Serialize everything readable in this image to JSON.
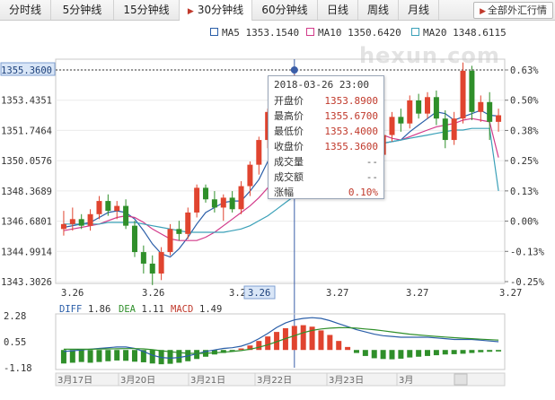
{
  "tabs": [
    {
      "label": "分时线",
      "active": false
    },
    {
      "label": "5分钟线",
      "active": false
    },
    {
      "label": "15分钟线",
      "active": false
    },
    {
      "label": "30分钟线",
      "active": true
    },
    {
      "label": "60分钟线",
      "active": false
    },
    {
      "label": "日线",
      "active": false
    },
    {
      "label": "周线",
      "active": false
    },
    {
      "label": "月线",
      "active": false
    }
  ],
  "fx_button": "全部外汇行情",
  "watermark": "hexun.com",
  "ma_legend": [
    {
      "name": "MA5",
      "value": "1353.1540",
      "color": "#2a5ea8"
    },
    {
      "name": "MA10",
      "value": "1350.6420",
      "color": "#d23a8a"
    },
    {
      "name": "MA20",
      "value": "1348.6115",
      "color": "#3aa0b8"
    }
  ],
  "tooltip": {
    "datetime": "2018-03-26 23:00",
    "rows": [
      {
        "label": "开盘价",
        "value": "1353.8900"
      },
      {
        "label": "最高价",
        "value": "1355.6700"
      },
      {
        "label": "最低价",
        "value": "1353.4000"
      },
      {
        "label": "收盘价",
        "value": "1355.3600"
      },
      {
        "label": "成交量",
        "value": "--"
      },
      {
        "label": "成交额",
        "value": "--"
      },
      {
        "label": "涨幅",
        "value": "0.10%"
      }
    ]
  },
  "chart_data": {
    "type": "candlestick",
    "current_price_label": "1355.3600",
    "current_price": 1355.36,
    "y_range": [
      1343.0,
      1356.6
    ],
    "y_ticks": [
      "1355.3600",
      "1353.4351",
      "1351.7464",
      "1350.0576",
      "1348.3689",
      "1346.6801",
      "1344.9914",
      "1343.3026"
    ],
    "pct_ticks": [
      "0.63%",
      "0.50%",
      "0.38%",
      "0.25%",
      "0.13%",
      "0.00%",
      "-0.13%",
      "-0.25%"
    ],
    "x_labels": [
      "3.26",
      "3.26",
      "3.2",
      "3.26",
      "3.27",
      "3.27",
      "3.27"
    ],
    "crosshair_label": "3.26",
    "candles": [
      {
        "o": 1346.3,
        "h": 1347.4,
        "l": 1345.9,
        "c": 1346.6
      },
      {
        "o": 1346.6,
        "h": 1347.6,
        "l": 1346.2,
        "c": 1346.9
      },
      {
        "o": 1346.9,
        "h": 1347.2,
        "l": 1346.3,
        "c": 1346.5
      },
      {
        "o": 1346.5,
        "h": 1347.5,
        "l": 1346.2,
        "c": 1347.2
      },
      {
        "o": 1347.2,
        "h": 1348.3,
        "l": 1346.9,
        "c": 1348.0
      },
      {
        "o": 1348.0,
        "h": 1348.4,
        "l": 1347.1,
        "c": 1347.4
      },
      {
        "o": 1347.4,
        "h": 1348.0,
        "l": 1346.9,
        "c": 1347.7
      },
      {
        "o": 1347.7,
        "h": 1348.1,
        "l": 1346.3,
        "c": 1346.5
      },
      {
        "o": 1346.5,
        "h": 1346.8,
        "l": 1344.6,
        "c": 1344.9
      },
      {
        "o": 1344.9,
        "h": 1345.3,
        "l": 1343.6,
        "c": 1344.2
      },
      {
        "o": 1344.2,
        "h": 1344.7,
        "l": 1342.9,
        "c": 1343.6
      },
      {
        "o": 1343.6,
        "h": 1345.2,
        "l": 1343.2,
        "c": 1344.9
      },
      {
        "o": 1344.9,
        "h": 1346.6,
        "l": 1344.7,
        "c": 1346.3
      },
      {
        "o": 1346.3,
        "h": 1346.8,
        "l": 1345.6,
        "c": 1346.0
      },
      {
        "o": 1346.0,
        "h": 1347.6,
        "l": 1345.7,
        "c": 1347.3
      },
      {
        "o": 1347.3,
        "h": 1349.0,
        "l": 1347.0,
        "c": 1348.8
      },
      {
        "o": 1348.8,
        "h": 1349.0,
        "l": 1347.9,
        "c": 1348.1
      },
      {
        "o": 1348.1,
        "h": 1348.6,
        "l": 1347.3,
        "c": 1347.6
      },
      {
        "o": 1347.6,
        "h": 1348.4,
        "l": 1346.8,
        "c": 1348.2
      },
      {
        "o": 1348.2,
        "h": 1348.6,
        "l": 1347.3,
        "c": 1347.5
      },
      {
        "o": 1347.5,
        "h": 1349.2,
        "l": 1347.2,
        "c": 1348.9
      },
      {
        "o": 1348.9,
        "h": 1350.4,
        "l": 1348.3,
        "c": 1350.2
      },
      {
        "o": 1350.2,
        "h": 1351.9,
        "l": 1349.6,
        "c": 1351.7
      },
      {
        "o": 1351.7,
        "h": 1353.6,
        "l": 1351.2,
        "c": 1353.4
      },
      {
        "o": 1353.4,
        "h": 1355.4,
        "l": 1352.8,
        "c": 1354.2
      },
      {
        "o": 1354.2,
        "h": 1355.3,
        "l": 1353.5,
        "c": 1353.9
      },
      {
        "o": 1353.9,
        "h": 1355.67,
        "l": 1353.4,
        "c": 1355.36
      },
      {
        "o": 1355.3,
        "h": 1355.6,
        "l": 1354.4,
        "c": 1354.7
      },
      {
        "o": 1354.7,
        "h": 1355.4,
        "l": 1354.2,
        "c": 1355.0
      },
      {
        "o": 1355.0,
        "h": 1355.2,
        "l": 1353.9,
        "c": 1354.3
      },
      {
        "o": 1352.0,
        "h": 1352.4,
        "l": 1350.6,
        "c": 1351.0
      },
      {
        "o": 1351.0,
        "h": 1352.0,
        "l": 1350.5,
        "c": 1351.7
      },
      {
        "o": 1351.7,
        "h": 1352.2,
        "l": 1350.8,
        "c": 1351.2
      },
      {
        "o": 1351.2,
        "h": 1352.4,
        "l": 1350.6,
        "c": 1352.1
      },
      {
        "o": 1352.1,
        "h": 1352.5,
        "l": 1351.3,
        "c": 1351.6
      },
      {
        "o": 1351.6,
        "h": 1352.0,
        "l": 1350.4,
        "c": 1350.8
      },
      {
        "o": 1350.8,
        "h": 1352.3,
        "l": 1350.6,
        "c": 1352.0
      },
      {
        "o": 1352.0,
        "h": 1353.4,
        "l": 1351.6,
        "c": 1353.1
      },
      {
        "o": 1353.1,
        "h": 1353.6,
        "l": 1352.2,
        "c": 1352.7
      },
      {
        "o": 1352.7,
        "h": 1354.4,
        "l": 1352.4,
        "c": 1354.1
      },
      {
        "o": 1354.1,
        "h": 1354.5,
        "l": 1353.0,
        "c": 1353.3
      },
      {
        "o": 1353.3,
        "h": 1354.6,
        "l": 1353.0,
        "c": 1354.3
      },
      {
        "o": 1354.3,
        "h": 1354.7,
        "l": 1352.6,
        "c": 1353.0
      },
      {
        "o": 1353.0,
        "h": 1353.5,
        "l": 1351.2,
        "c": 1351.7
      },
      {
        "o": 1351.7,
        "h": 1353.4,
        "l": 1351.4,
        "c": 1353.0
      },
      {
        "o": 1353.0,
        "h": 1356.4,
        "l": 1352.7,
        "c": 1355.9
      },
      {
        "o": 1355.9,
        "h": 1356.2,
        "l": 1352.9,
        "c": 1353.4
      },
      {
        "o": 1353.4,
        "h": 1354.4,
        "l": 1352.8,
        "c": 1354.0
      },
      {
        "o": 1354.0,
        "h": 1354.6,
        "l": 1351.7,
        "c": 1352.8
      },
      {
        "o": 1352.8,
        "h": 1353.6,
        "l": 1352.2,
        "c": 1353.2
      }
    ],
    "ma": [
      {
        "name": "MA5",
        "color": "#2a5ea8",
        "values": [
          1346.4,
          1346.5,
          1346.6,
          1346.7,
          1347.0,
          1347.3,
          1347.4,
          1347.3,
          1346.9,
          1346.2,
          1345.4,
          1344.8,
          1344.6,
          1345.1,
          1345.8,
          1346.6,
          1347.3,
          1347.6,
          1347.9,
          1348.0,
          1348.0,
          1348.6,
          1349.3,
          1350.4,
          1351.6,
          1352.5,
          1353.5,
          1354.0,
          1354.5,
          1354.6,
          1354.2,
          1353.4,
          1352.6,
          1351.7,
          1351.5,
          1351.3,
          1351.5,
          1351.6,
          1351.7,
          1352.2,
          1352.6,
          1353.0,
          1353.4,
          1353.3,
          1352.9,
          1353.1,
          1353.3,
          1353.5,
          1353.2,
          1353.15
        ]
      },
      {
        "name": "MA10",
        "color": "#d23a8a",
        "values": [
          1346.2,
          1346.3,
          1346.4,
          1346.5,
          1346.6,
          1346.8,
          1347.0,
          1347.1,
          1347.0,
          1346.7,
          1346.3,
          1346.0,
          1345.7,
          1345.6,
          1345.6,
          1345.6,
          1345.8,
          1346.1,
          1346.5,
          1346.9,
          1347.3,
          1347.7,
          1348.2,
          1348.8,
          1349.4,
          1350.1,
          1350.8,
          1351.6,
          1352.3,
          1352.9,
          1353.1,
          1353.2,
          1353.0,
          1352.8,
          1352.5,
          1352.3,
          1352.0,
          1351.8,
          1351.7,
          1351.9,
          1352.1,
          1352.3,
          1352.5,
          1352.6,
          1352.7,
          1352.9,
          1353.0,
          1352.9,
          1352.8,
          1350.64
        ]
      },
      {
        "name": "MA20",
        "color": "#3aa0b8",
        "values": [
          1346.6,
          1346.6,
          1346.6,
          1346.6,
          1346.6,
          1346.7,
          1346.7,
          1346.7,
          1346.7,
          1346.6,
          1346.5,
          1346.4,
          1346.3,
          1346.2,
          1346.1,
          1346.1,
          1346.1,
          1346.1,
          1346.1,
          1346.2,
          1346.3,
          1346.5,
          1346.8,
          1347.1,
          1347.5,
          1347.9,
          1348.3,
          1348.7,
          1349.1,
          1349.5,
          1349.9,
          1350.3,
          1350.6,
          1350.9,
          1351.1,
          1351.3,
          1351.5,
          1351.6,
          1351.7,
          1351.8,
          1351.9,
          1352.0,
          1352.1,
          1352.2,
          1352.3,
          1352.3,
          1352.4,
          1352.4,
          1352.4,
          1348.61
        ]
      }
    ],
    "macd": {
      "diff_label": "DIFF",
      "diff_value": "1.86",
      "dea_label": "DEA",
      "dea_value": "1.11",
      "macd_label": "MACD",
      "macd_value": "1.49",
      "y_range": [
        -1.3,
        2.4
      ],
      "y_ticks": [
        "2.28",
        "0.55",
        "-1.18"
      ],
      "diff": [
        -0.1,
        -0.05,
        0.0,
        0.05,
        0.1,
        0.15,
        0.2,
        0.2,
        0.1,
        -0.1,
        -0.35,
        -0.5,
        -0.55,
        -0.5,
        -0.4,
        -0.25,
        -0.1,
        0.0,
        0.1,
        0.15,
        0.25,
        0.45,
        0.75,
        1.1,
        1.5,
        1.8,
        2.0,
        2.1,
        2.15,
        2.1,
        1.95,
        1.75,
        1.55,
        1.35,
        1.2,
        1.05,
        0.95,
        0.9,
        0.85,
        0.85,
        0.85,
        0.85,
        0.8,
        0.75,
        0.7,
        0.7,
        0.7,
        0.65,
        0.6,
        0.55
      ],
      "dea": [
        0.05,
        0.05,
        0.05,
        0.05,
        0.06,
        0.07,
        0.08,
        0.09,
        0.09,
        0.07,
        0.02,
        -0.05,
        -0.12,
        -0.18,
        -0.22,
        -0.23,
        -0.22,
        -0.19,
        -0.15,
        -0.1,
        -0.04,
        0.05,
        0.18,
        0.35,
        0.55,
        0.75,
        0.95,
        1.15,
        1.3,
        1.4,
        1.45,
        1.48,
        1.48,
        1.45,
        1.4,
        1.35,
        1.28,
        1.2,
        1.12,
        1.05,
        1.0,
        0.95,
        0.9,
        0.86,
        0.82,
        0.78,
        0.75,
        0.72,
        0.69,
        0.66
      ],
      "bars": [
        -0.9,
        -0.85,
        -0.8,
        -0.85,
        -0.8,
        -0.75,
        -0.7,
        -0.72,
        -0.78,
        -0.82,
        -0.9,
        -0.95,
        -0.92,
        -0.85,
        -0.75,
        -0.6,
        -0.45,
        -0.3,
        -0.2,
        -0.1,
        0.1,
        0.3,
        0.6,
        0.9,
        1.2,
        1.45,
        1.6,
        1.65,
        1.55,
        1.3,
        1.0,
        0.6,
        0.2,
        -0.2,
        -0.4,
        -0.55,
        -0.6,
        -0.62,
        -0.58,
        -0.5,
        -0.45,
        -0.4,
        -0.35,
        -0.3,
        -0.28,
        -0.25,
        -0.2,
        -0.15,
        -0.12,
        -0.1
      ]
    },
    "date_labels": [
      "3月17日",
      "3月20日",
      "3月21日",
      "3月22日",
      "3月23日",
      "3月"
    ]
  }
}
